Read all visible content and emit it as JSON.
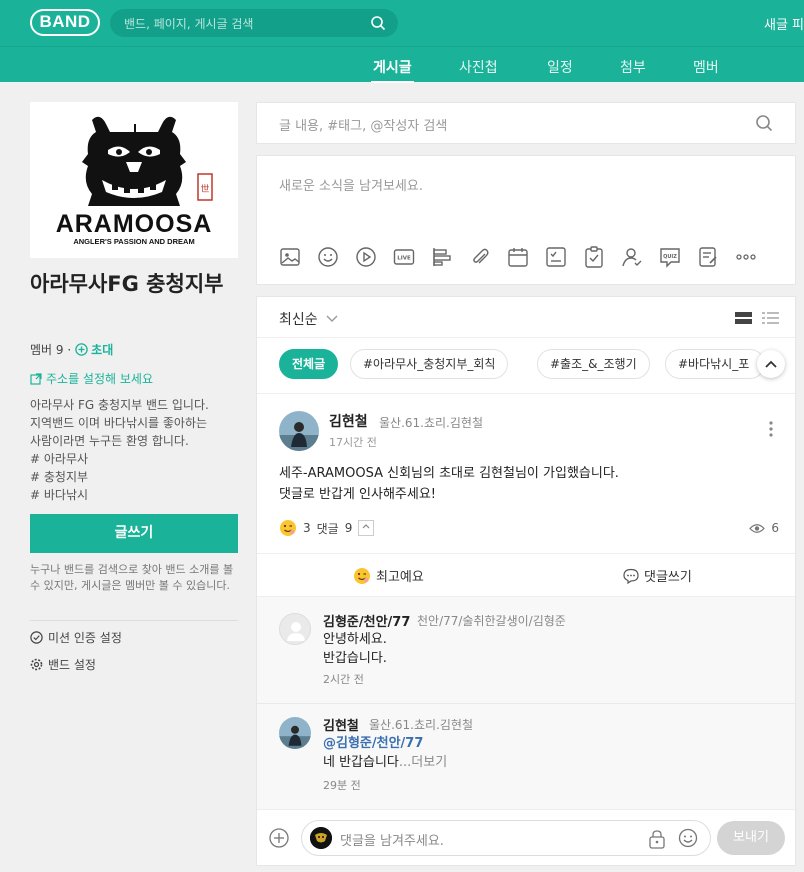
{
  "header": {
    "logo": "BAND",
    "search_placeholder": "밴드, 페이지, 게시글 검색",
    "right_text": "새글 피"
  },
  "tabs": [
    {
      "label": "게시글",
      "active": true
    },
    {
      "label": "사진첩",
      "active": false
    },
    {
      "label": "일정",
      "active": false
    },
    {
      "label": "첨부",
      "active": false
    },
    {
      "label": "멤버",
      "active": false
    }
  ],
  "band": {
    "cover_text": "ARAMOOSA",
    "cover_subtext": "ANGLER'S PASSION AND DREAM",
    "name": "아라무사FG 충청지부",
    "member_label": "멤버 9 ·",
    "invite_label": "초대",
    "address_label": "주소를 설정해 보세요",
    "description": [
      "아라무사 FG 충청지부 밴드 입니다.",
      "지역밴드 이며 바다낚시를 좋아하는",
      "사람이라면 누구든 환영 합니다.",
      "# 아라무사",
      "# 충청지부",
      "# 바다낚시"
    ],
    "write_button": "글쓰기",
    "notice": "누구나 밴드를 검색으로 찾아 밴드 소개를 볼 수 있지만, 게시글은 멤버만 볼 수 있습니다.",
    "settings": [
      "미션 인증 설정",
      "밴드 설정"
    ]
  },
  "post_search": {
    "placeholder": "글 내용, #태그, @작성자 검색"
  },
  "composer": {
    "placeholder": "새로운 소식을 남겨보세요.",
    "tools": [
      "image-icon",
      "emoji-icon",
      "video-icon",
      "live-icon",
      "poll-icon",
      "attach-icon",
      "calendar-icon",
      "checklist-icon",
      "todo-icon",
      "person-icon",
      "quiz-icon",
      "memo-icon",
      "more-icon"
    ],
    "live_label": "LIVE",
    "quiz_label": "QUIZ"
  },
  "feed": {
    "sort_label": "최신순",
    "chips": [
      {
        "label": "전체글",
        "active": true
      },
      {
        "label": "#아라무사_충청지부_회칙",
        "active": false
      },
      {
        "label": "#출조_&_조행기",
        "active": false
      },
      {
        "label": "#바다낚시_포",
        "active": false
      }
    ]
  },
  "post": {
    "author": "김현철",
    "author_sub": "울산.61.쵸리.김현철",
    "time": "17시간 전",
    "body": [
      "세주-ARAMOOSA 신회님의 초대로 김현철님이 가입했습니다.",
      "댓글로 반갑게 인사해주세요!"
    ],
    "reaction_count": "3",
    "comment_label": "댓글",
    "comment_count": "9",
    "views": "6",
    "like_action": "최고예요",
    "comment_action": "댓글쓰기"
  },
  "comments": [
    {
      "author": "김형준/천안/77",
      "sub": "천안/77/술취한갈생이/김형준",
      "lines": [
        "안녕하세요.",
        "반갑습니다."
      ],
      "time": "2시간 전"
    },
    {
      "author": "김현철",
      "sub": "울산.61.쵸리.김현철",
      "mention": "@김형준/천안/77",
      "text": "네 반갑습니다",
      "more": "...더보기",
      "time": "29분 전"
    }
  ],
  "reply": {
    "placeholder": "댓글을 남겨주세요.",
    "send_label": "보내기"
  },
  "colors": {
    "brand": "#1ab39a",
    "mention": "#3a6fb0"
  }
}
